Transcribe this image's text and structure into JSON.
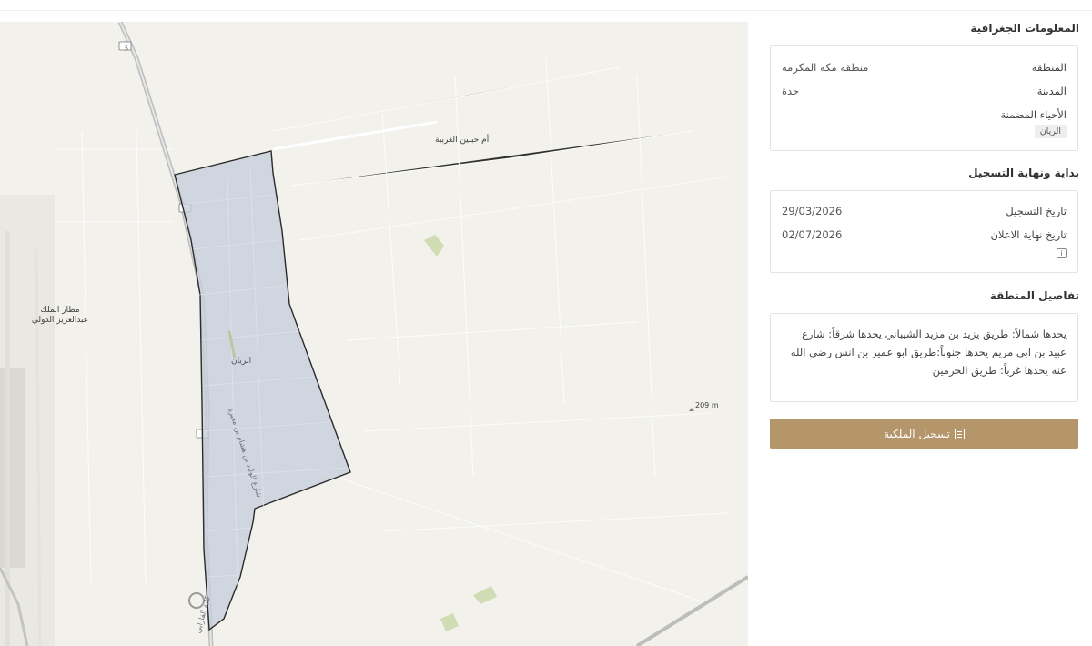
{
  "map": {
    "labels": {
      "neighborhood": "الريان",
      "um_hablain": "أم حبلين الغربية",
      "airport": "مطار الملك\nعبدالعزيز الدولي",
      "elevation": "209 m",
      "street": "شارع الوليد بن هشام بن مغيرة",
      "college": "كلية الفارابي",
      "road_shield": "5"
    }
  },
  "geo": {
    "title": "المعلومات الجغرافية",
    "region_label": "المنطقة",
    "region_value": "منطقة مكة المكرمة",
    "city_label": "المدينة",
    "city_value": "جدة",
    "districts_label": "الأحياء المضمنة",
    "districts": [
      "الريان"
    ]
  },
  "registration": {
    "title": "بداية ونهاية التسجيل",
    "start_label": "تاريخ التسجيل",
    "start_value": "29/03/2026",
    "end_label": "تاريخ نهاية الاعلان",
    "end_value": "02/07/2026"
  },
  "area": {
    "title": "تفاصيل المنطقة",
    "description": "يحدها شمالاً: طريق يزيد بن مزيد الشيباني يحدها شرقاً: شارع عبيد بن ابي مريم يحدها جنوباً:طريق ابو عمير بن انس رضي الله عنه يحدها غرباً: طريق الحرمين"
  },
  "action": {
    "register_label": "تسجيل الملكية",
    "icon": "building-icon"
  },
  "colors": {
    "accent": "#b5956a",
    "polygon_fill": "#c7cedb",
    "map_bg": "#f2f1ec"
  }
}
